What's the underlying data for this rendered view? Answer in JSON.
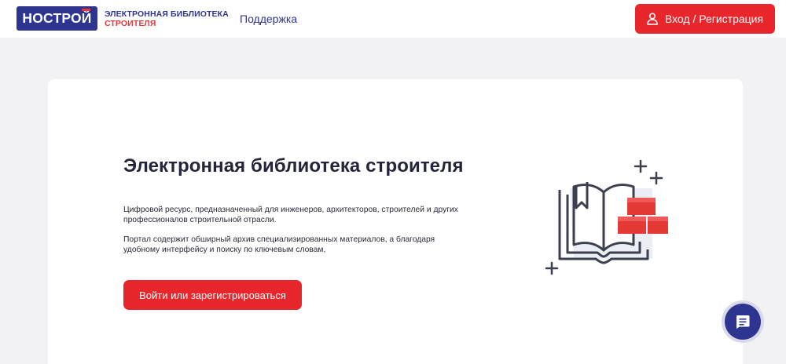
{
  "header": {
    "logo": {
      "brand": "НОСТРОЙ",
      "line1": "ЭЛЕКТРОННАЯ БИБЛИОТЕКА",
      "line2": "СТРОИТЕЛЯ"
    },
    "nav": {
      "support": "Поддержка"
    },
    "login": {
      "label": "Вход / Регистрация",
      "icon": "user-icon"
    }
  },
  "hero": {
    "title": "Электронная библиотека строителя",
    "paragraph1": "Цифровой ресурс, предназначенный для инженеров, архитекторов, строителей и других профессионалов строительной отрасли.",
    "paragraph2": "Портал содержит обширный архив специализированных материалов, а благодаря удобному интерфейсу и поиску по ключевым словам,",
    "cta": "Войти или зарегистрироваться",
    "illustration": "book-bricks-illustration"
  },
  "chat": {
    "icon": "chat-icon"
  },
  "colors": {
    "brand_blue": "#2e3591",
    "brand_red": "#e8262c",
    "background": "#f2f2f5",
    "card": "#ffffff"
  }
}
